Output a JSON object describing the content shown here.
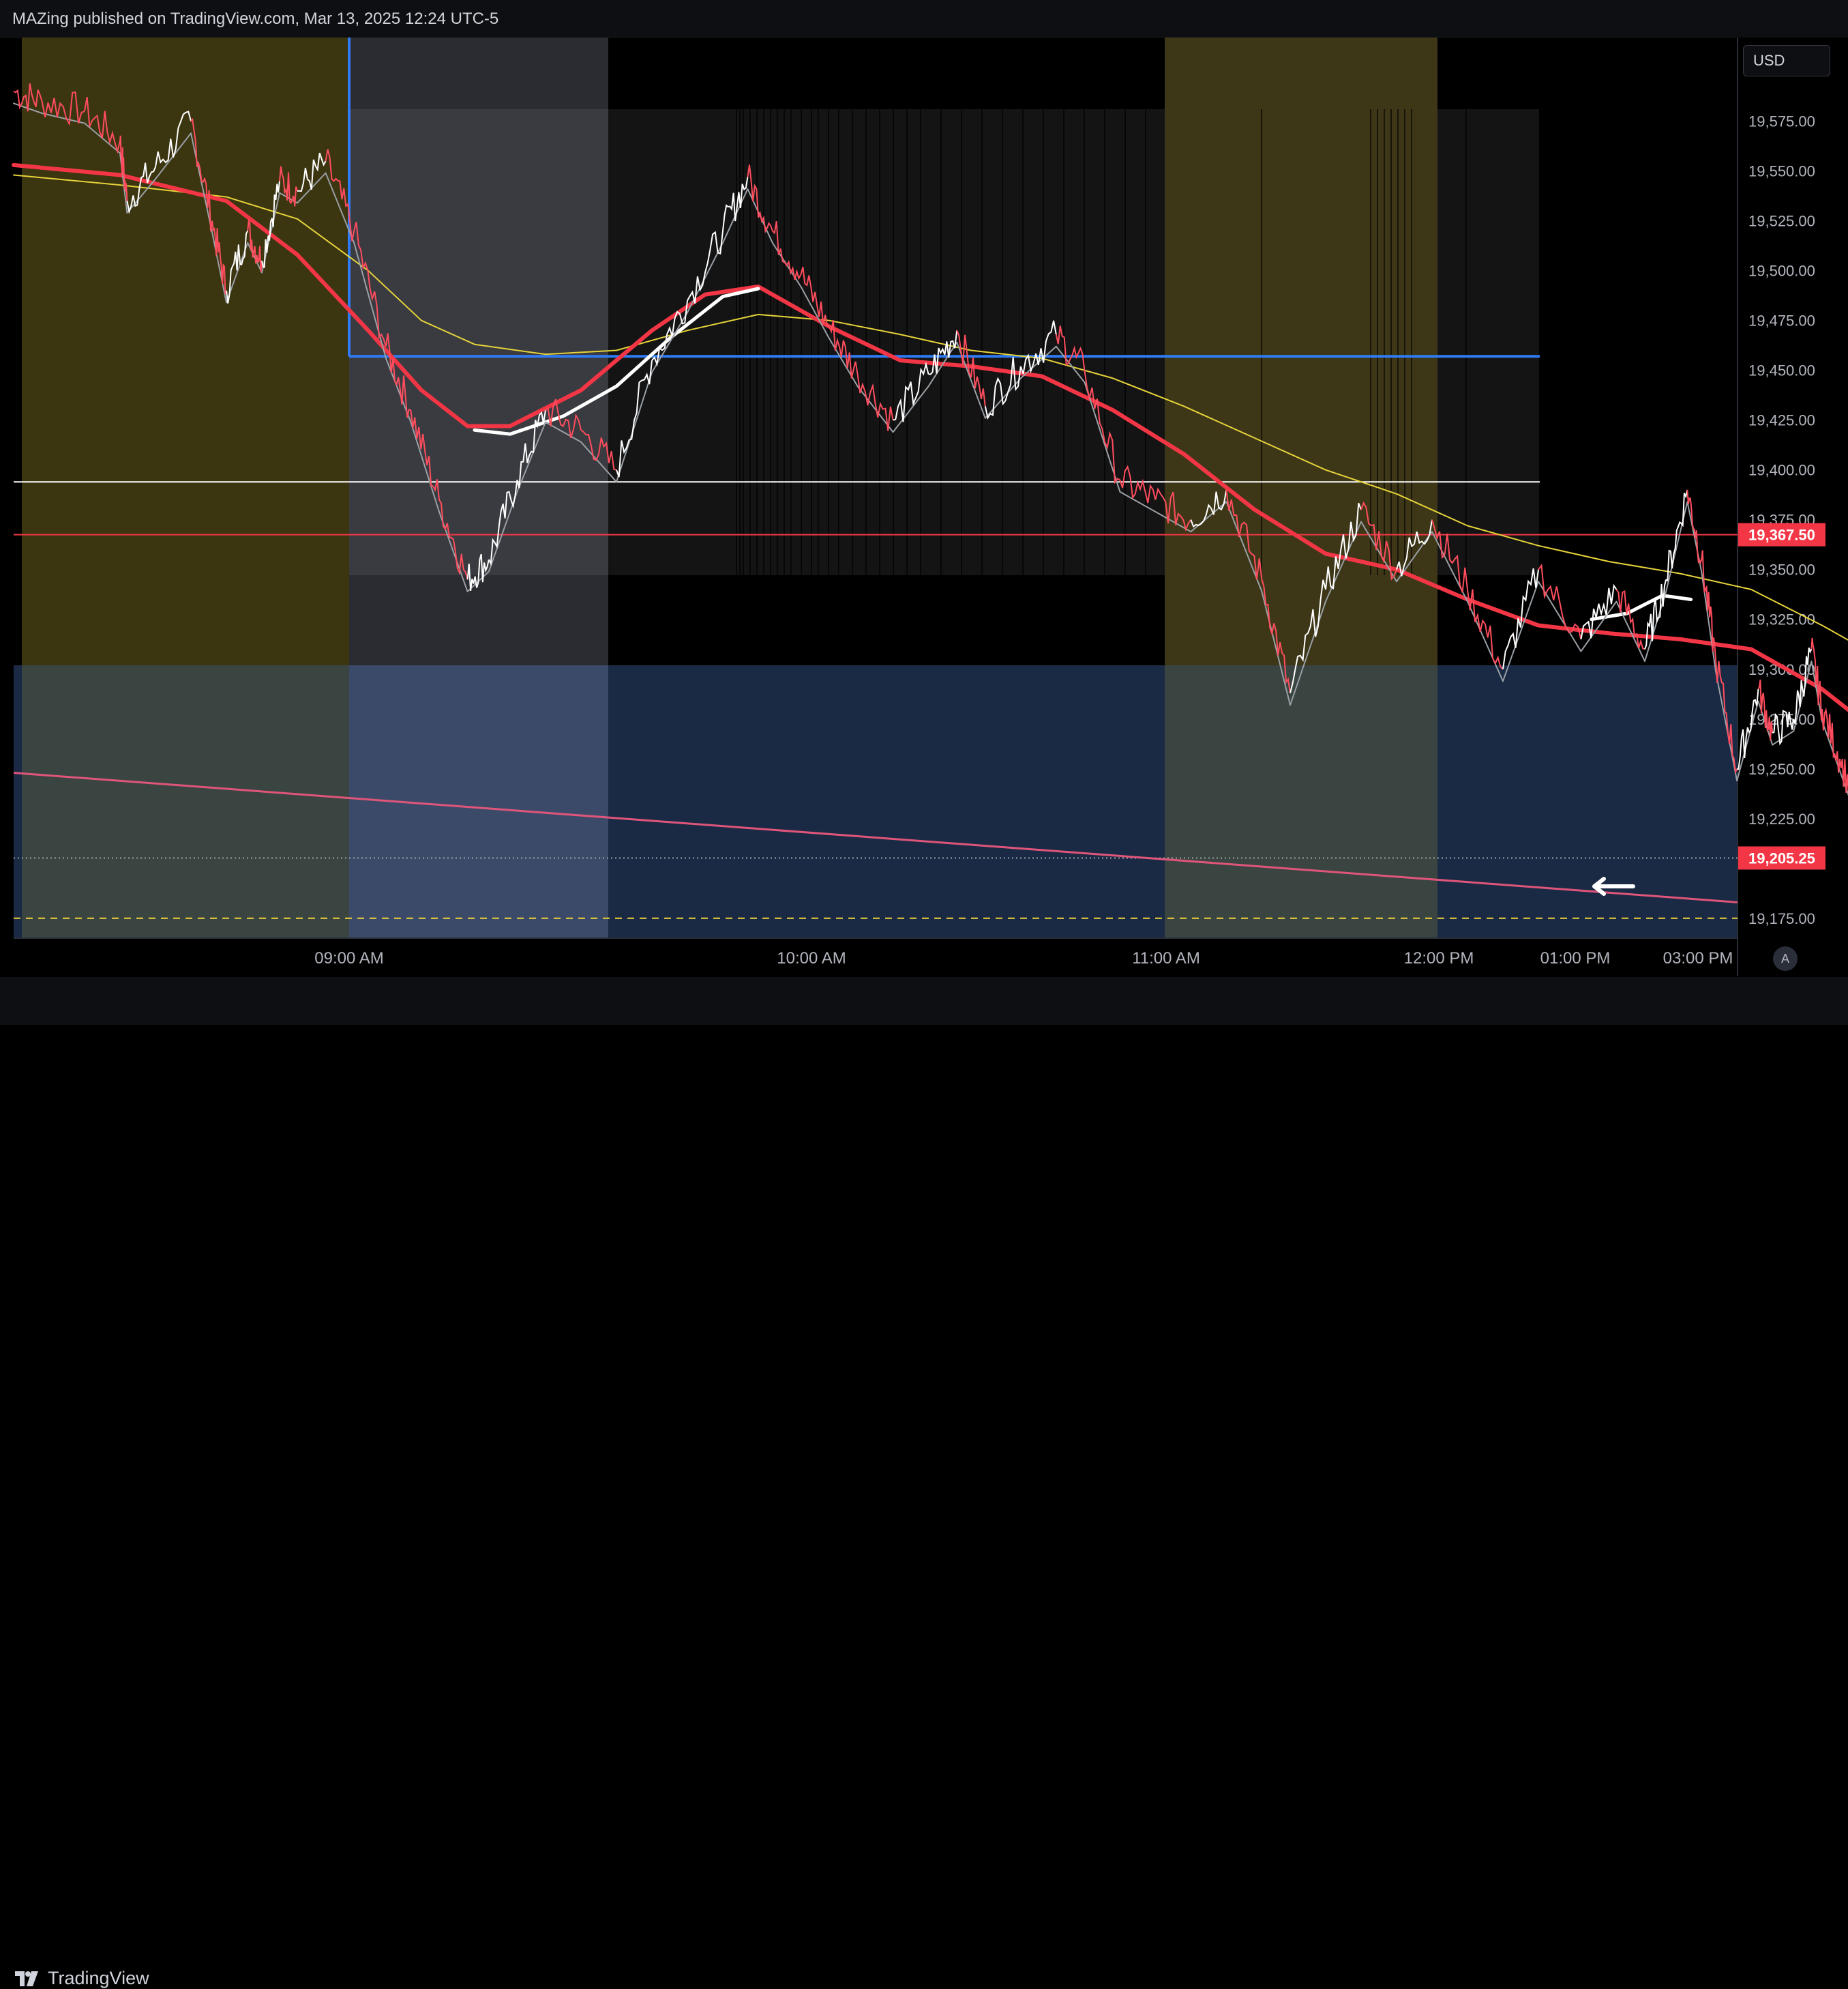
{
  "header": {
    "publish_text": "MAZing published on TradingView.com, Mar 13, 2025 12:24 UTC-5"
  },
  "footer": {
    "brand": "TradingView",
    "brand_icon": "tradingview-logo-icon"
  },
  "toolbar": {
    "currency_label": "USD",
    "auto_scale_label": "A"
  },
  "colors": {
    "background": "#000000",
    "price_line_white": "#ffffff",
    "ema_red": "#f23645",
    "price_red": "#ff4d5e",
    "sma_yellow": "#e6d33a",
    "ma_gray": "#9aa0a6",
    "trendline_pink": "#e0557a",
    "blue_level": "#2f7bf5",
    "red_level": "#f23645",
    "yellow_dashed": "#f0d43a",
    "session_olive": "#3b3510",
    "session_gray": "#2a2c32",
    "zone_blue": "#1a2a45"
  },
  "chart_data": {
    "type": "line",
    "symbol_timeframe": "intraday",
    "x_axis": {
      "tick_labels": [
        "09:00 AM",
        "10:00 AM",
        "11:00 AM",
        "12:00 PM",
        "01:00 PM",
        "03:00 PM"
      ]
    },
    "y_axis": {
      "tick_labels": [
        "19,575.00",
        "19,550.00",
        "19,525.00",
        "19,500.00",
        "19,475.00",
        "19,450.00",
        "19,425.00",
        "19,400.00",
        "19,375.00",
        "19,350.00",
        "19,325.00",
        "19,300.00",
        "19,275.00",
        "19,250.00",
        "19,225.00",
        "19,175.00"
      ],
      "ylim": [
        19165,
        19617
      ]
    },
    "price_labels": [
      {
        "label": "19,367.50",
        "value": 19367.5,
        "color": "#f23645"
      },
      {
        "label": "19,205.25",
        "value": 19205.25,
        "color": "#f23645"
      }
    ],
    "levels": [
      {
        "name": "blue-level",
        "value": 19457,
        "color": "#2f7bf5",
        "style": "solid"
      },
      {
        "name": "white-level",
        "value": 19394,
        "color": "#ffffff",
        "style": "solid"
      },
      {
        "name": "red-level",
        "value": 19367.5,
        "color": "#f23645",
        "style": "solid"
      },
      {
        "name": "last-price-dotted",
        "value": 19205.25,
        "color": "#9aa0a6",
        "style": "dotted"
      },
      {
        "name": "yellow-dashed-level",
        "value": 19175,
        "color": "#f0d43a",
        "style": "dashed"
      }
    ],
    "price_series": [
      {
        "t": 0.0,
        "v": 19590
      },
      {
        "t": 0.08,
        "v": 19585
      },
      {
        "t": 0.2,
        "v": 19580
      },
      {
        "t": 0.3,
        "v": 19565
      },
      {
        "t": 0.32,
        "v": 19535
      },
      {
        "t": 0.4,
        "v": 19552
      },
      {
        "t": 0.5,
        "v": 19575
      },
      {
        "t": 0.56,
        "v": 19525
      },
      {
        "t": 0.6,
        "v": 19490
      },
      {
        "t": 0.66,
        "v": 19520
      },
      {
        "t": 0.7,
        "v": 19505
      },
      {
        "t": 0.75,
        "v": 19545
      },
      {
        "t": 0.8,
        "v": 19540
      },
      {
        "t": 0.88,
        "v": 19555
      },
      {
        "t": 0.96,
        "v": 19520
      },
      {
        "t": 1.05,
        "v": 19462
      },
      {
        "t": 1.12,
        "v": 19430
      },
      {
        "t": 1.2,
        "v": 19385
      },
      {
        "t": 1.28,
        "v": 19345
      },
      {
        "t": 1.34,
        "v": 19355
      },
      {
        "t": 1.42,
        "v": 19395
      },
      {
        "t": 1.5,
        "v": 19430
      },
      {
        "t": 1.6,
        "v": 19420
      },
      {
        "t": 1.7,
        "v": 19400
      },
      {
        "t": 1.8,
        "v": 19455
      },
      {
        "t": 1.9,
        "v": 19485
      },
      {
        "t": 2.0,
        "v": 19520
      },
      {
        "t": 2.07,
        "v": 19547
      },
      {
        "t": 2.14,
        "v": 19520
      },
      {
        "t": 2.22,
        "v": 19498
      },
      {
        "t": 2.3,
        "v": 19472
      },
      {
        "t": 2.38,
        "v": 19448
      },
      {
        "t": 2.48,
        "v": 19425
      },
      {
        "t": 2.58,
        "v": 19448
      },
      {
        "t": 2.66,
        "v": 19470
      },
      {
        "t": 2.74,
        "v": 19432
      },
      {
        "t": 2.84,
        "v": 19452
      },
      {
        "t": 2.94,
        "v": 19468
      },
      {
        "t": 3.02,
        "v": 19450
      },
      {
        "t": 3.12,
        "v": 19395
      },
      {
        "t": 3.22,
        "v": 19385
      },
      {
        "t": 3.32,
        "v": 19375
      },
      {
        "t": 3.42,
        "v": 19390
      },
      {
        "t": 3.52,
        "v": 19345
      },
      {
        "t": 3.6,
        "v": 19288
      },
      {
        "t": 3.7,
        "v": 19340
      },
      {
        "t": 3.8,
        "v": 19380
      },
      {
        "t": 3.9,
        "v": 19350
      },
      {
        "t": 4.0,
        "v": 19375
      },
      {
        "t": 4.1,
        "v": 19340
      },
      {
        "t": 4.2,
        "v": 19300
      },
      {
        "t": 4.3,
        "v": 19350
      },
      {
        "t": 4.42,
        "v": 19315
      },
      {
        "t": 4.52,
        "v": 19340
      },
      {
        "t": 4.6,
        "v": 19310
      },
      {
        "t": 4.66,
        "v": 19345
      },
      {
        "t": 4.72,
        "v": 19390
      },
      {
        "t": 4.76,
        "v": 19355
      },
      {
        "t": 4.8,
        "v": 19305
      },
      {
        "t": 4.86,
        "v": 19250
      },
      {
        "t": 4.92,
        "v": 19290
      },
      {
        "t": 4.96,
        "v": 19268
      },
      {
        "t": 5.02,
        "v": 19275
      },
      {
        "t": 5.07,
        "v": 19310
      },
      {
        "t": 5.1,
        "v": 19280
      },
      {
        "t": 5.15,
        "v": 19255
      },
      {
        "t": 5.2,
        "v": 19230
      },
      {
        "t": 5.25,
        "v": 19200
      },
      {
        "t": 5.29,
        "v": 19188
      },
      {
        "t": 5.33,
        "v": 19218
      },
      {
        "t": 5.36,
        "v": 19205
      }
    ],
    "ema_red": [
      {
        "t": 0.0,
        "v": 19553
      },
      {
        "t": 0.3,
        "v": 19548
      },
      {
        "t": 0.6,
        "v": 19535
      },
      {
        "t": 0.8,
        "v": 19508
      },
      {
        "t": 1.0,
        "v": 19470
      },
      {
        "t": 1.15,
        "v": 19440
      },
      {
        "t": 1.28,
        "v": 19422
      },
      {
        "t": 1.4,
        "v": 19422
      },
      {
        "t": 1.6,
        "v": 19440
      },
      {
        "t": 1.8,
        "v": 19470
      },
      {
        "t": 1.95,
        "v": 19488
      },
      {
        "t": 2.1,
        "v": 19492
      },
      {
        "t": 2.3,
        "v": 19472
      },
      {
        "t": 2.5,
        "v": 19455
      },
      {
        "t": 2.7,
        "v": 19452
      },
      {
        "t": 2.9,
        "v": 19447
      },
      {
        "t": 3.1,
        "v": 19430
      },
      {
        "t": 3.3,
        "v": 19408
      },
      {
        "t": 3.5,
        "v": 19380
      },
      {
        "t": 3.7,
        "v": 19358
      },
      {
        "t": 3.9,
        "v": 19350
      },
      {
        "t": 4.1,
        "v": 19335
      },
      {
        "t": 4.3,
        "v": 19322
      },
      {
        "t": 4.5,
        "v": 19318
      },
      {
        "t": 4.7,
        "v": 19315
      },
      {
        "t": 4.9,
        "v": 19310
      },
      {
        "t": 5.1,
        "v": 19290
      },
      {
        "t": 5.3,
        "v": 19262
      }
    ],
    "sma_yellow": [
      {
        "t": 0.0,
        "v": 19548
      },
      {
        "t": 0.3,
        "v": 19543
      },
      {
        "t": 0.6,
        "v": 19537
      },
      {
        "t": 0.8,
        "v": 19526
      },
      {
        "t": 1.0,
        "v": 19500
      },
      {
        "t": 1.15,
        "v": 19475
      },
      {
        "t": 1.3,
        "v": 19463
      },
      {
        "t": 1.5,
        "v": 19458
      },
      {
        "t": 1.7,
        "v": 19460
      },
      {
        "t": 1.9,
        "v": 19470
      },
      {
        "t": 2.1,
        "v": 19478
      },
      {
        "t": 2.3,
        "v": 19475
      },
      {
        "t": 2.5,
        "v": 19468
      },
      {
        "t": 2.7,
        "v": 19460
      },
      {
        "t": 2.9,
        "v": 19456
      },
      {
        "t": 3.1,
        "v": 19446
      },
      {
        "t": 3.3,
        "v": 19432
      },
      {
        "t": 3.5,
        "v": 19416
      },
      {
        "t": 3.7,
        "v": 19400
      },
      {
        "t": 3.9,
        "v": 19388
      },
      {
        "t": 4.1,
        "v": 19372
      },
      {
        "t": 4.3,
        "v": 19362
      },
      {
        "t": 4.5,
        "v": 19354
      },
      {
        "t": 4.7,
        "v": 19348
      },
      {
        "t": 4.9,
        "v": 19340
      },
      {
        "t": 5.1,
        "v": 19322
      },
      {
        "t": 5.3,
        "v": 19302
      }
    ],
    "ma_white": [
      {
        "t": 1.3,
        "v": 19420
      },
      {
        "t": 1.4,
        "v": 19418
      },
      {
        "t": 1.55,
        "v": 19427
      },
      {
        "t": 1.7,
        "v": 19442
      },
      {
        "t": 1.85,
        "v": 19466
      },
      {
        "t": 2.0,
        "v": 19487
      },
      {
        "t": 2.1,
        "v": 19491
      }
    ],
    "ma_white_2": [
      {
        "t": 4.45,
        "v": 19325
      },
      {
        "t": 4.55,
        "v": 19328
      },
      {
        "t": 4.65,
        "v": 19337
      },
      {
        "t": 4.73,
        "v": 19335
      }
    ],
    "trendline": {
      "start": 19248,
      "end": 19183
    }
  }
}
